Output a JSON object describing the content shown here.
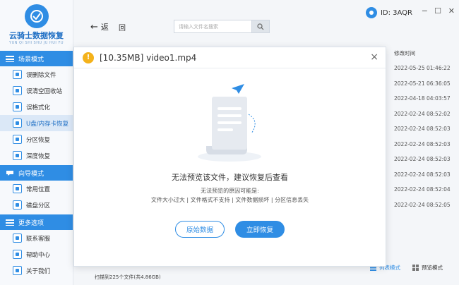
{
  "app": {
    "logo_title": "云骑士数据恢复",
    "logo_sub": "YUN QI SHI SHU JU HUI FU"
  },
  "sidebar": {
    "sections": [
      {
        "title": "场景模式",
        "items": [
          "误删除文件",
          "误清空回收站",
          "误格式化",
          "U盘/内存卡恢复",
          "分区恢复",
          "深度恢复"
        ],
        "active": 3
      },
      {
        "title": "向导模式",
        "items": [
          "常用位置",
          "磁盘分区"
        ]
      },
      {
        "title": "更多选项",
        "items": [
          "联系客服",
          "帮助中心",
          "关于我们"
        ]
      }
    ]
  },
  "topbar": {
    "back_label": "返",
    "home_label": "回",
    "search_placeholder": "请输入文件名搜索",
    "user_id": "ID: 3AQR",
    "win_min": "−",
    "win_max": "☐",
    "win_close": "✕"
  },
  "time_column": {
    "header": "修改时间",
    "values": [
      "2022-05-25 01:46:22",
      "2022-05-21 06:36:05",
      "2022-04-18 04:03:57",
      "2022-02-24 08:52:02",
      "2022-02-24 08:52:03",
      "2022-02-24 08:52:03",
      "2022-02-24 08:52:03",
      "2022-02-24 08:52:03",
      "2022-02-24 08:52:04",
      "2022-02-24 08:52:05"
    ]
  },
  "status": {
    "scan_text": "扫描到225个文件(共4.86GB)",
    "list_mode": "列表模式",
    "preview_mode": "预览模式"
  },
  "modal": {
    "title": "[10.35MB] video1.mp4",
    "close": "×",
    "message": "无法预览该文件，建议恢复后查看",
    "reason_title": "无法预览的原因可能是:",
    "reasons": "文件大小过大 | 文件格式不支持 | 文件数据损坏 | 分区信息丢失",
    "btn_original": "原始数据",
    "btn_recover": "立即恢复"
  },
  "colors": {
    "accent": "#2f8de4",
    "warning": "#f4b21b"
  }
}
